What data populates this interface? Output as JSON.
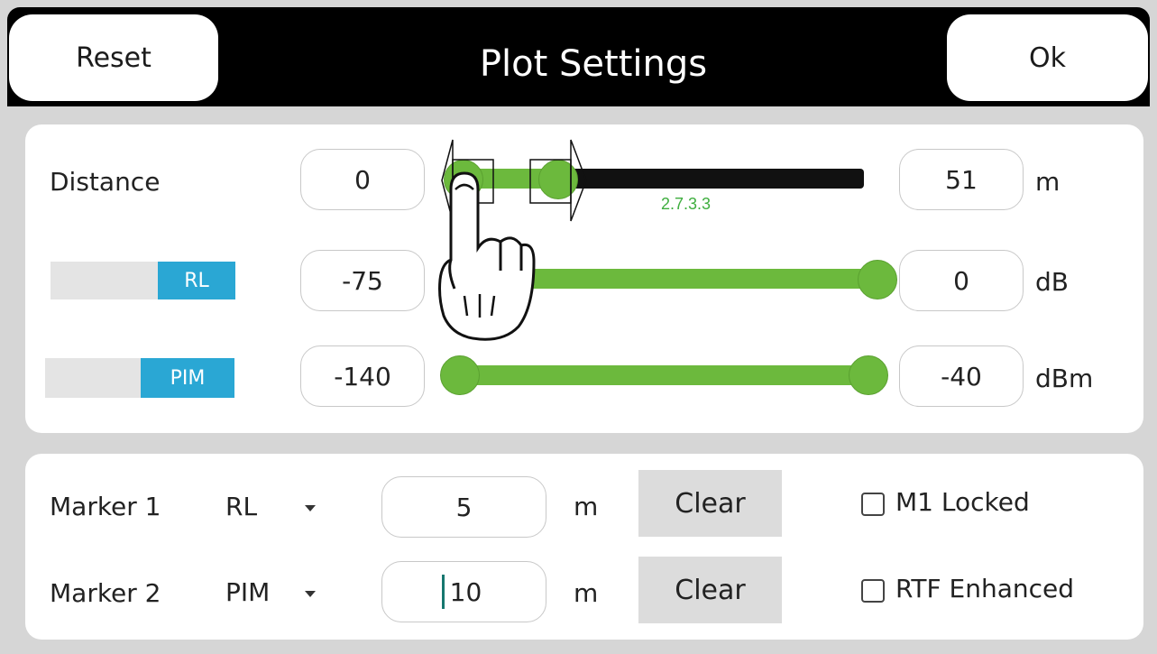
{
  "header": {
    "reset_label": "Reset",
    "title": "Plot Settings",
    "ok_label": "Ok"
  },
  "ranges": {
    "distance": {
      "label": "Distance",
      "min": "0",
      "max": "51",
      "unit": "m",
      "version_text": "2.7.3.3"
    },
    "rl": {
      "toggle_label": "RL",
      "min": "-75",
      "max": "0",
      "unit": "dB"
    },
    "pim": {
      "toggle_label": "PIM",
      "min": "-140",
      "max": "-40",
      "unit": "dBm"
    }
  },
  "markers": {
    "m1": {
      "label": "Marker 1",
      "trace": "RL",
      "value": "5",
      "unit": "m",
      "clear_label": "Clear",
      "checkbox_label": "M1 Locked"
    },
    "m2": {
      "label": "Marker 2",
      "trace": "PIM",
      "value": "10",
      "unit": "m",
      "clear_label": "Clear",
      "checkbox_label": "RTF Enhanced"
    }
  },
  "colors": {
    "accent_green": "#6cb93d",
    "toggle_blue": "#2aa7d4",
    "header_bg": "#000000"
  }
}
